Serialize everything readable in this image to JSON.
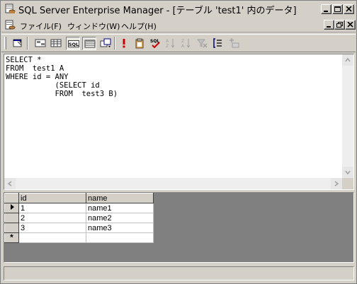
{
  "window": {
    "title": "SQL Server Enterprise Manager - [テーブル 'test1' 内のデータ]"
  },
  "menu": {
    "items": [
      {
        "label": "ファイル(F)"
      },
      {
        "label": "ウィンドウ(W)"
      },
      {
        "label": "ヘルプ(H)"
      }
    ]
  },
  "toolbar": {
    "buttons": [
      {
        "name": "properties-icon"
      },
      {
        "name": "show-diagram-pane-icon"
      },
      {
        "name": "show-grid-pane-icon"
      },
      {
        "name": "show-sql-pane-icon",
        "label": "SQL",
        "pressed": true
      },
      {
        "name": "show-results-pane-icon",
        "pressed": true
      },
      {
        "name": "change-query-type-icon"
      },
      {
        "name": "run-icon"
      },
      {
        "name": "verify-sql-icon"
      },
      {
        "name": "check-sql-syntax-icon"
      },
      {
        "name": "sort-ascending-icon"
      },
      {
        "name": "sort-descending-icon"
      },
      {
        "name": "remove-filter-icon"
      },
      {
        "name": "group-by-icon"
      },
      {
        "name": "add-table-icon"
      }
    ]
  },
  "sql_pane": {
    "text": "SELECT *\nFROM  test1 A\nWHERE id = ANY\n           (SELECT id\n           FROM  test3 B)"
  },
  "results": {
    "columns": [
      "id",
      "name"
    ],
    "rows": [
      {
        "marker": "current",
        "id": "1",
        "name": "name1"
      },
      {
        "marker": "",
        "id": "2",
        "name": "name2"
      },
      {
        "marker": "",
        "id": "3",
        "name": "name3"
      },
      {
        "marker": "new",
        "id": "",
        "name": ""
      }
    ],
    "new_row_marker": "*"
  },
  "colors": {
    "face": "#d4d0c8",
    "pane": "#ffffff",
    "grid_background": "#808080",
    "run_icon": "#cc0000"
  }
}
